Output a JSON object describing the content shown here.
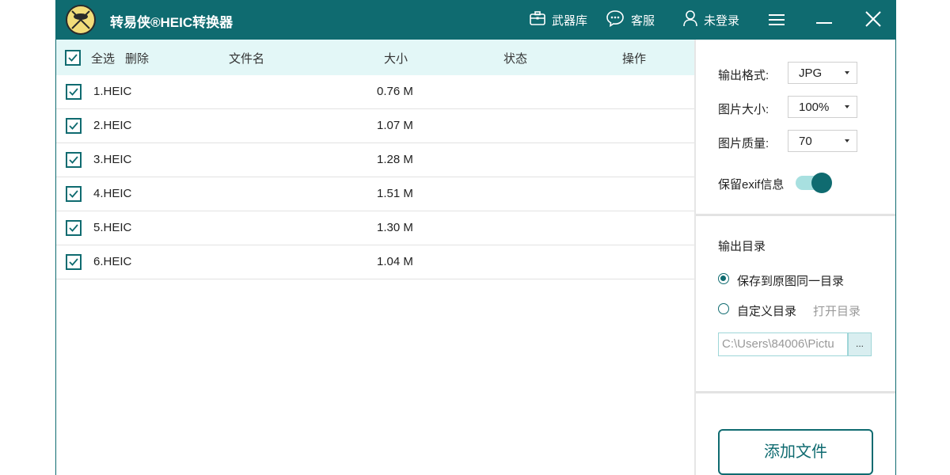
{
  "app": {
    "title": "转易侠®HEIC转换器",
    "logo_text": "HEIC",
    "accent_color": "#0f6b70"
  },
  "toolbar": {
    "toolbox_label": "武器库",
    "support_label": "客服",
    "login_label": "未登录",
    "toolbox_icon": "briefcase-icon",
    "support_icon": "chat-bubble-icon",
    "login_icon": "user-icon",
    "menu_icon": "hamburger-menu-icon",
    "minimize_icon": "minimize-icon",
    "close_icon": "close-icon"
  },
  "list": {
    "header": {
      "select_all": "全选",
      "delete": "删除",
      "filename": "文件名",
      "size": "大小",
      "status": "状态",
      "action": "操作"
    },
    "rows": [
      {
        "name": "1.HEIC",
        "size": "0.76 M",
        "checked": true
      },
      {
        "name": "2.HEIC",
        "size": "1.07 M",
        "checked": true
      },
      {
        "name": "3.HEIC",
        "size": "1.28 M",
        "checked": true
      },
      {
        "name": "4.HEIC",
        "size": "1.51 M",
        "checked": true
      },
      {
        "name": "5.HEIC",
        "size": "1.30 M",
        "checked": true
      },
      {
        "name": "6.HEIC",
        "size": "1.04 M",
        "checked": true
      }
    ]
  },
  "settings": {
    "format_label": "输出格式:",
    "format_value": "JPG",
    "size_label": "图片大小:",
    "size_value": "100%",
    "quality_label": "图片质量:",
    "quality_value": "70",
    "exif_label": "保留exif信息",
    "exif_enabled": true
  },
  "output": {
    "title": "输出目录",
    "option_same": "保存到原图同一目录",
    "option_custom": "自定义目录",
    "open_dir": "打开目录",
    "selected": "same",
    "path_value": "C:\\Users\\84006\\Pictu",
    "browse_label": "..."
  },
  "add_file_label": "添加文件"
}
